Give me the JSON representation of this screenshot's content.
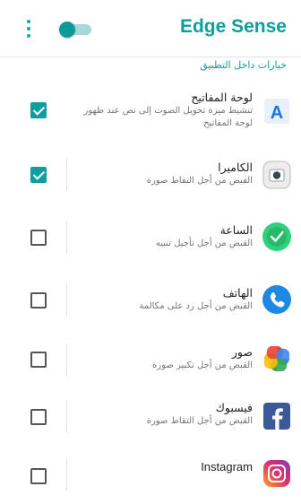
{
  "header": {
    "title": "Edge Sense",
    "menu_icon": "more-vert-icon",
    "master_toggle": {
      "state": "on"
    }
  },
  "section": {
    "label": "خيارات داخل التطبيق"
  },
  "items": [
    {
      "title": "لوحة المفاتيح",
      "subtitle": "تنشيط ميزة تحويل الصوت إلى نص عند ظهور لوحة المفاتيح",
      "checked": true,
      "icon": "keyboard-app-icon"
    },
    {
      "title": "الكاميرا",
      "subtitle": "القبض من أجل التقاط صورة",
      "checked": true,
      "icon": "camera-app-icon"
    },
    {
      "title": "الساعة",
      "subtitle": "القبض من أجل تأجيل تنبيه",
      "checked": false,
      "icon": "clock-app-icon"
    },
    {
      "title": "الهاتف",
      "subtitle": "القبض من أجل رد على مكالمة",
      "checked": false,
      "icon": "phone-app-icon"
    },
    {
      "title": "صور",
      "subtitle": "القبض من أجل تكبير صورة",
      "checked": false,
      "icon": "photos-app-icon"
    },
    {
      "title": "فيسبوك",
      "subtitle": "القبض من أجل التقاط صورة",
      "checked": false,
      "icon": "facebook-app-icon"
    },
    {
      "title": "Instagram",
      "subtitle": "",
      "checked": false,
      "icon": "instagram-app-icon"
    }
  ],
  "colors": {
    "accent": "#0e9e9e"
  }
}
